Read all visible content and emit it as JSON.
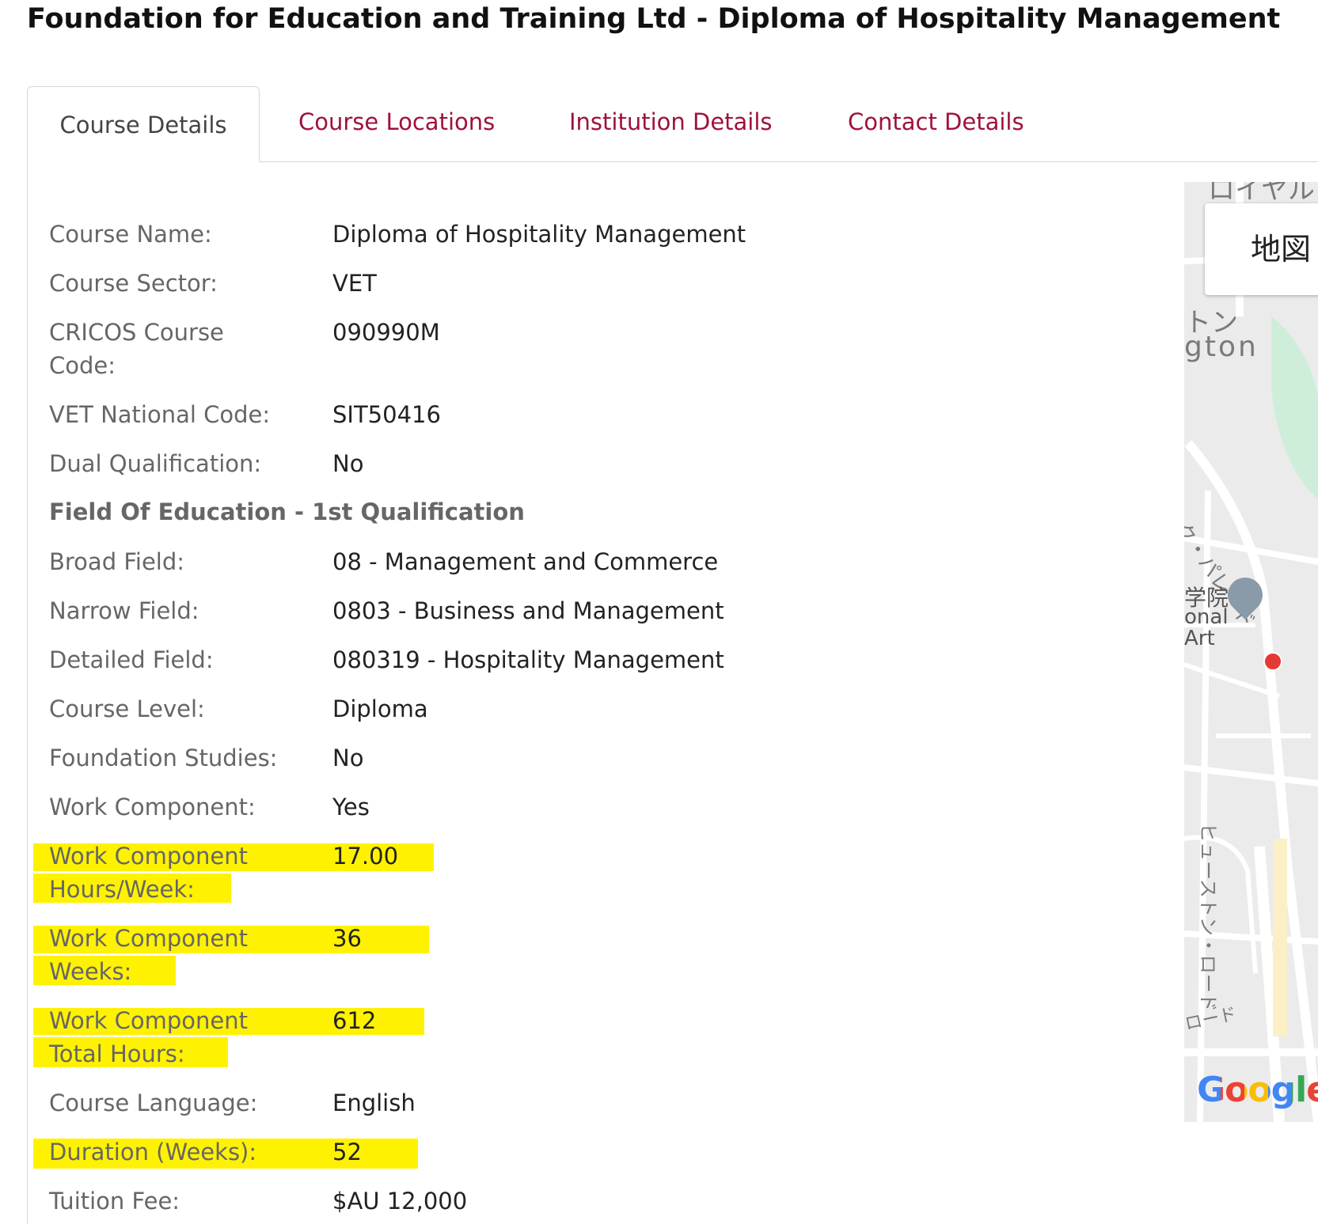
{
  "page": {
    "title": "Foundation for Education and Training Ltd - Diploma of Hospitality Management"
  },
  "tabs": [
    {
      "label": "Course Details",
      "active": true
    },
    {
      "label": "Course Locations",
      "active": false
    },
    {
      "label": "Institution Details",
      "active": false
    },
    {
      "label": "Contact Details",
      "active": false
    }
  ],
  "details": [
    {
      "label": "Course Name:",
      "value": "Diploma of Hospitality Management"
    },
    {
      "label": "Course Sector:",
      "value": "VET"
    },
    {
      "label": "CRICOS Course Code:",
      "value": "090990M"
    },
    {
      "label": "VET National Code:",
      "value": "SIT50416"
    },
    {
      "label": "Dual Qualification:",
      "value": "No"
    }
  ],
  "field_of_education": {
    "heading": "Field Of Education - 1st Qualification",
    "rows": [
      {
        "label": "Broad Field:",
        "value": "08 - Management and Commerce"
      },
      {
        "label": "Narrow Field:",
        "value": "0803 - Business and Management"
      },
      {
        "label": "Detailed Field:",
        "value": "080319 - Hospitality Management"
      },
      {
        "label": "Course Level:",
        "value": "Diploma"
      },
      {
        "label": "Foundation Studies:",
        "value": "No"
      },
      {
        "label": "Work Component:",
        "value": "Yes"
      },
      {
        "label": "Work Component Hours/Week:",
        "value": "17.00"
      },
      {
        "label": "Work Component Weeks:",
        "value": "36"
      },
      {
        "label": "Work Component Total Hours:",
        "value": "612"
      },
      {
        "label": "Course Language:",
        "value": "English"
      },
      {
        "label": "Duration (Weeks):",
        "value": "52"
      },
      {
        "label": "Tuition Fee:",
        "value": "$AU 12,000"
      }
    ]
  },
  "highlight_color": "#fff200",
  "accent_color": "#a0113a",
  "map": {
    "control_label": "地図",
    "labels": [
      "ロイヤル",
      "トン",
      "gton",
      "ック・パレード",
      "学院",
      "onal",
      "Art",
      "ヒューストン・ロード",
      "ロード"
    ],
    "attribution": "Google"
  }
}
